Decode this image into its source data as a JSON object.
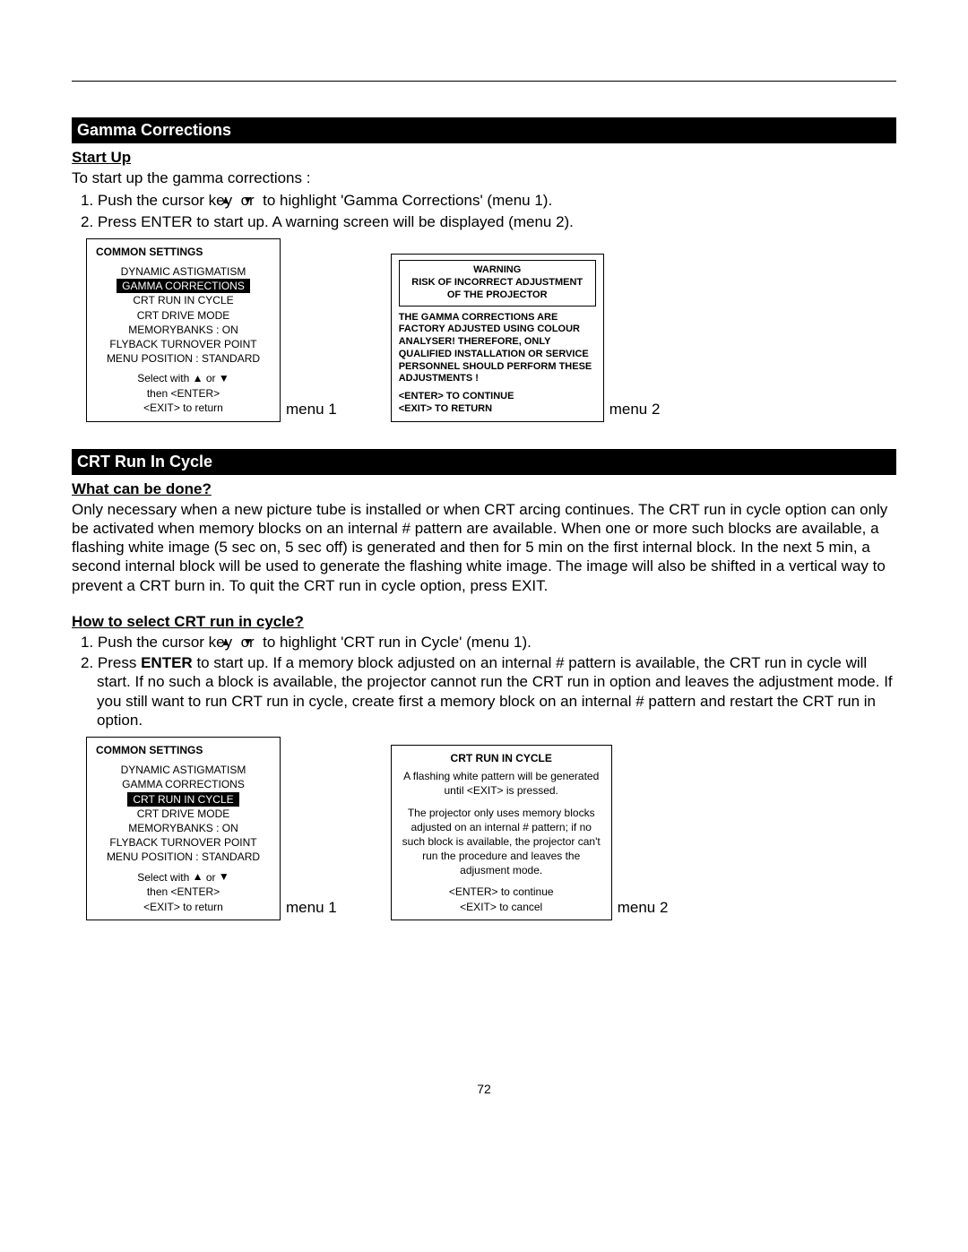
{
  "section1": {
    "bar": "Gamma Corrections",
    "subhead": "Start Up",
    "intro": "To start up the gamma corrections :",
    "step1_prefix": "1. Push the cursor key ",
    "step1_or": " or ",
    "step1_suffix": " to highlight 'Gamma Corrections' (menu 1).",
    "step2": "2. Press ENTER to start up. A warning screen will be displayed (menu 2).",
    "menu1": {
      "title": "COMMON SETTINGS",
      "items": [
        "DYNAMIC ASTIGMATISM",
        "GAMMA CORRECTIONS",
        "CRT RUN IN CYCLE",
        "CRT DRIVE MODE",
        "MEMORYBANKS : ON",
        "FLYBACK TURNOVER POINT",
        "MENU POSITION : STANDARD"
      ],
      "highlightIndex": 1,
      "hint_select_pre": "Select with ",
      "hint_select_mid": " or ",
      "hint_then": "then <ENTER>",
      "hint_exit": "<EXIT> to return",
      "label": "menu 1"
    },
    "menu2": {
      "warn1": "WARNING",
      "warn2": "RISK OF INCORRECT ADJUSTMENT",
      "warn3": "OF THE PROJECTOR",
      "para": "THE GAMMA CORRECTIONS ARE FACTORY ADJUSTED USING COLOUR ANALYSER! THEREFORE, ONLY QUALIFIED INSTALLATION OR SERVICE PERSONNEL SHOULD PERFORM THESE ADJUSTMENTS !",
      "enter": "<ENTER> TO CONTINUE",
      "exit": "<EXIT> TO RETURN",
      "label": "menu 2"
    }
  },
  "section2": {
    "bar": "CRT Run In Cycle",
    "subhead1": "What can be done?",
    "para": "Only necessary when a new picture tube is installed or when CRT arcing continues. The CRT run in cycle option can only be activated when memory blocks on an internal # pattern are available. When one or more such blocks are available, a flashing white image (5 sec on, 5 sec off) is generated and then for 5 min on the first internal block. In the next 5 min, a second internal block will be used to generate the flashing white image. The image will also be shifted in a vertical way to prevent a CRT burn in. To quit the CRT run in cycle option, press EXIT.",
    "subhead2": "How to select CRT run in cycle?",
    "step1_prefix": "1. Push the cursor key ",
    "step1_or": " or ",
    "step1_suffix": " to highlight 'CRT run in Cycle' (menu 1).",
    "step2_a": "2. Press ",
    "step2_b": "ENTER",
    "step2_c": " to start up. If a memory block adjusted on an internal # pattern is available, the CRT run in cycle will start. If no such a block is available, the projector cannot run the CRT run in option and leaves the adjustment mode. If you still want to run CRT run in cycle, create first a memory block  on an internal # pattern and restart the CRT run in option.",
    "menu1": {
      "title": "COMMON SETTINGS",
      "items": [
        "DYNAMIC ASTIGMATISM",
        "GAMMA CORRECTIONS",
        "CRT RUN IN CYCLE",
        "CRT DRIVE MODE",
        "MEMORYBANKS : ON",
        "FLYBACK TURNOVER POINT",
        "MENU POSITION : STANDARD"
      ],
      "highlightIndex": 2,
      "hint_select_pre": "Select with ",
      "hint_select_mid": " or ",
      "hint_then": "then <ENTER>",
      "hint_exit": "<EXIT> to return",
      "label": "menu 1"
    },
    "menu2": {
      "title": "CRT RUN IN CYCLE",
      "p1": "A flashing white pattern will be generated until <EXIT> is pressed.",
      "p2": "The projector only uses memory blocks adjusted on an internal # pattern; if no such block is available, the projector can't run the procedure and leaves the adjusment mode.",
      "enter": "<ENTER> to continue",
      "exit": "<EXIT> to cancel",
      "label": "menu 2"
    }
  },
  "pageNumber": "72"
}
